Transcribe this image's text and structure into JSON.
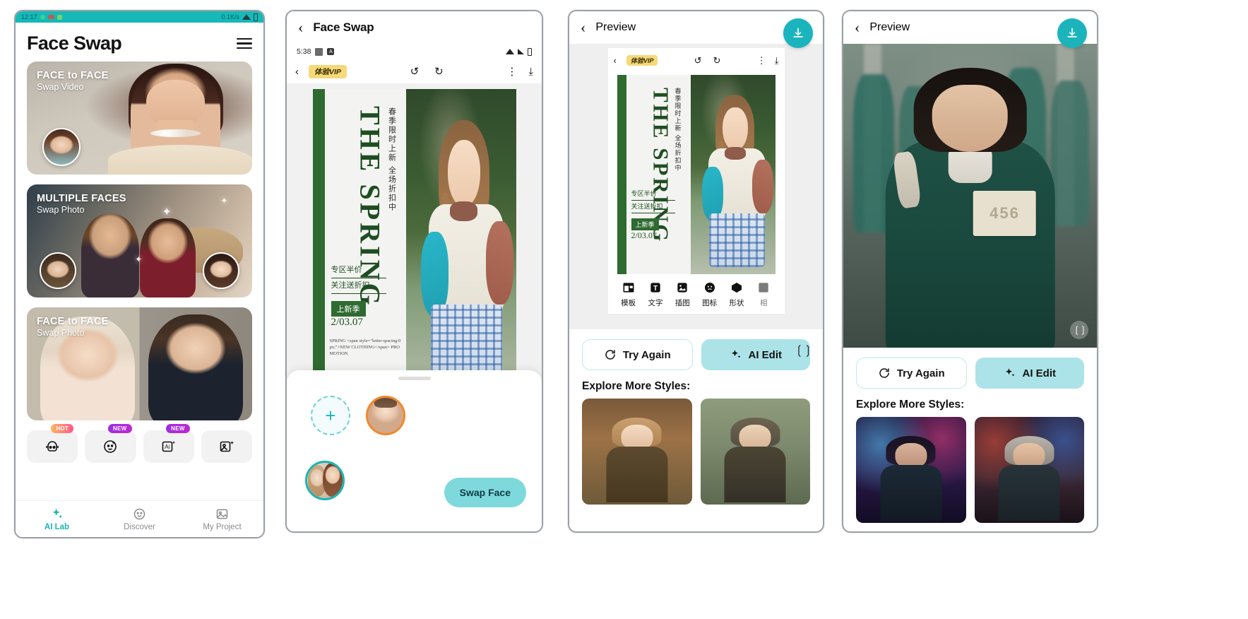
{
  "panel1": {
    "status_bar": {
      "time": "12:17",
      "right_text": "0.1K/s"
    },
    "title": "Face Swap",
    "menu_icon": "hamburger-menu-icon",
    "cards": [
      {
        "title": "FACE to FACE",
        "subtitle": "Swap Video"
      },
      {
        "title": "MULTIPLE FACES",
        "subtitle": "Swap Photo"
      },
      {
        "title": "FACE to FACE",
        "subtitle": "Swap Photo"
      }
    ],
    "tools": [
      {
        "icon": "avatar-icon",
        "badge": "HOT"
      },
      {
        "icon": "beauty-face-icon",
        "badge": "NEW"
      },
      {
        "icon": "ai-image-icon",
        "badge": "NEW"
      },
      {
        "icon": "photo-enhance-icon",
        "badge": ""
      }
    ],
    "tabs": [
      {
        "label": "AI Lab",
        "icon": "sparkle-icon",
        "active": true
      },
      {
        "label": "Discover",
        "icon": "smiley-icon",
        "active": false
      },
      {
        "label": "My Project",
        "icon": "gallery-icon",
        "active": false
      }
    ]
  },
  "panel2": {
    "nav_title": "Face Swap",
    "back_icon": "chevron-left-icon",
    "inner_status": {
      "time": "5:38"
    },
    "editor_toolbar": {
      "back_icon": "chevron-left-icon",
      "vip_label": "体验VIP",
      "undo_icon": "undo-icon",
      "redo_icon": "redo-icon",
      "more_icon": "more-vertical-icon",
      "download_icon": "download-icon"
    },
    "poster": {
      "headline": "THE SPRING",
      "cn_headline": "春季限时上新 全场折扣中",
      "line1": "专区半价",
      "line2": "关注送折扣",
      "tag": "上新季",
      "date": "2/03.07",
      "code": "SPRING <span style=\"letter-spacing:0px;\">NEW CLOTHING</span> PROMOTION"
    },
    "sheet": {
      "add_face_icon": "plus-icon",
      "selected_face": "target-face-avatar",
      "source_face": "source-photo-avatar",
      "swap_button": "Swap Face"
    }
  },
  "panel3": {
    "nav_title": "Preview",
    "back_icon": "chevron-left-icon",
    "download_icon": "download-icon",
    "editor_toolbar": {
      "back_icon": "chevron-left-icon",
      "vip_label": "体验VIP",
      "undo_icon": "undo-icon",
      "redo_icon": "redo-icon",
      "more_icon": "more-vertical-icon",
      "download_icon": "download-icon"
    },
    "poster": {
      "headline": "THE SPRING",
      "cn_headline": "春季限时上新 全场折扣中",
      "line1": "专区半价",
      "line2": "关注送折扣",
      "tag": "上新季",
      "date": "2/03.07"
    },
    "edit_tools": [
      {
        "label": "模板",
        "icon": "template-icon"
      },
      {
        "label": "文字",
        "icon": "text-icon"
      },
      {
        "label": "插图",
        "icon": "illustration-icon"
      },
      {
        "label": "图标",
        "icon": "sticker-icon"
      },
      {
        "label": "形状",
        "icon": "shape-icon"
      },
      {
        "label": "相",
        "icon": "frame-icon"
      }
    ],
    "compare_icon": "compare-slider-icon",
    "actions": {
      "try_again": "Try Again",
      "try_again_icon": "refresh-icon",
      "ai_edit": "AI Edit",
      "ai_edit_icon": "sparkle-icon"
    },
    "explore_title": "Explore More Styles:",
    "style_tiles": [
      "floral-hat-woman-style",
      "tweed-cap-man-style"
    ]
  },
  "panel4": {
    "nav_title": "Preview",
    "back_icon": "chevron-left-icon",
    "download_icon": "download-icon",
    "hero": {
      "number_patch": "456",
      "compare_icon": "compare-slider-icon"
    },
    "actions": {
      "try_again": "Try Again",
      "try_again_icon": "refresh-icon",
      "ai_edit": "AI Edit",
      "ai_edit_icon": "sparkle-icon"
    },
    "explore_title": "Explore More Styles:",
    "style_tiles": [
      "neon-woman-style",
      "neon-elder-man-style"
    ]
  },
  "colors": {
    "teal": "#19b5b5",
    "teal_light": "#abe3e8",
    "badge_hot": "#ff5b8a",
    "badge_new": "#9b2fe0",
    "orange_ring": "#f0892c"
  }
}
